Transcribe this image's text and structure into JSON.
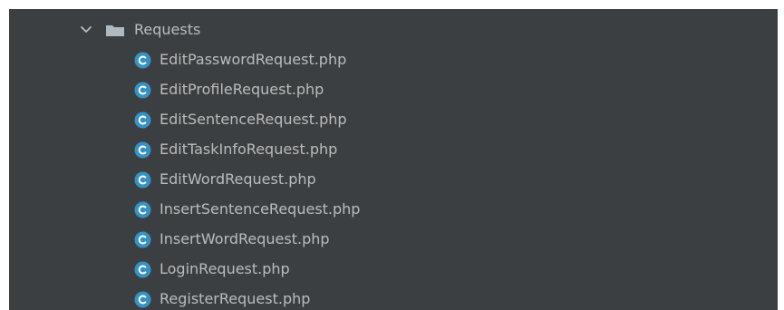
{
  "tree": {
    "folder": {
      "label": "Requests",
      "icon": "folder-icon",
      "expanded_icon": "chevron-down-icon"
    },
    "files": [
      {
        "label": "EditPasswordRequest.php",
        "icon": "php-class-icon"
      },
      {
        "label": "EditProfileRequest.php",
        "icon": "php-class-icon"
      },
      {
        "label": "EditSentenceRequest.php",
        "icon": "php-class-icon"
      },
      {
        "label": "EditTaskInfoRequest.php",
        "icon": "php-class-icon"
      },
      {
        "label": "EditWordRequest.php",
        "icon": "php-class-icon"
      },
      {
        "label": "InsertSentenceRequest.php",
        "icon": "php-class-icon"
      },
      {
        "label": "InsertWordRequest.php",
        "icon": "php-class-icon"
      },
      {
        "label": "LoginRequest.php",
        "icon": "php-class-icon"
      },
      {
        "label": "RegisterRequest.php",
        "icon": "php-class-icon"
      }
    ]
  },
  "colors": {
    "panel_background": "#3c3f41",
    "text": "#bbbbbb",
    "class_icon": "#3592c4",
    "folder": "#a9b7c6"
  }
}
